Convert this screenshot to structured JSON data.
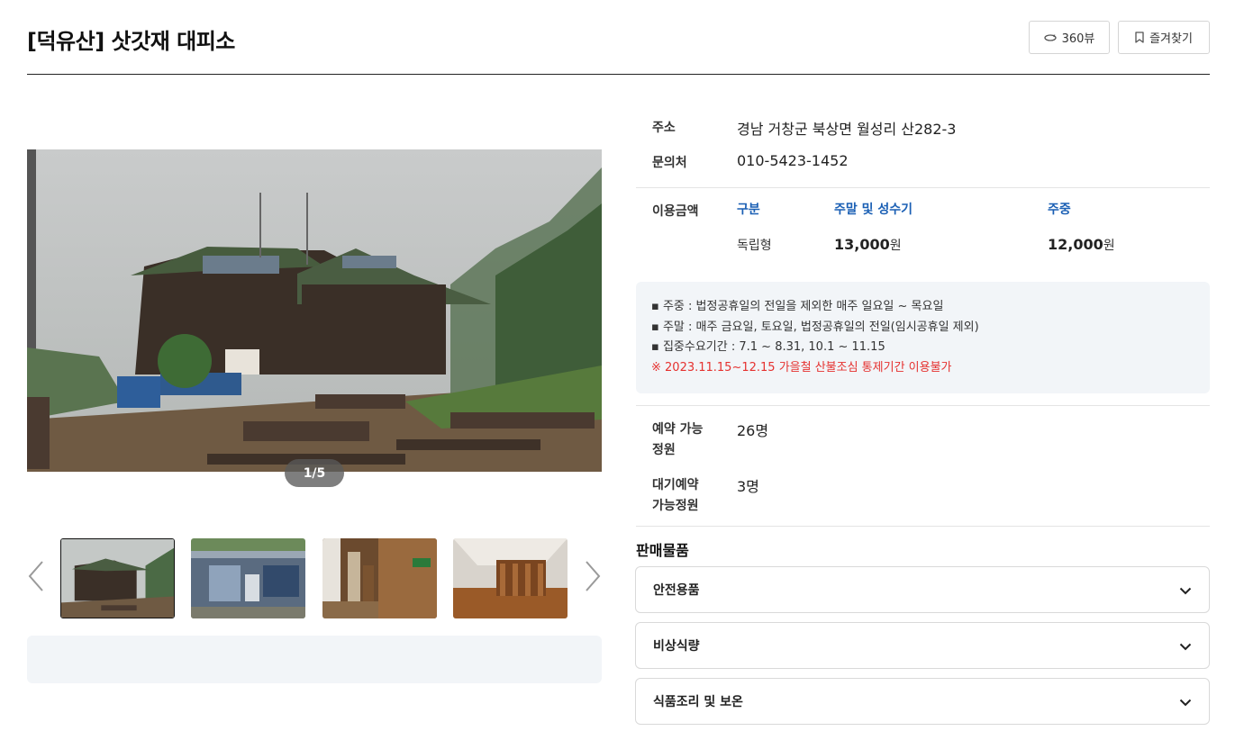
{
  "page": {
    "title": "[덕유산] 삿갓재 대피소"
  },
  "header": {
    "view360_label": "360뷰",
    "favorite_label": "즐겨찾기"
  },
  "gallery": {
    "counter": "1/5"
  },
  "info": {
    "address_label": "주소",
    "address": "경남 거창군 북상면 월성리 산282-3",
    "contact_label": "문의처",
    "contact": "010-5423-1452",
    "fee_label": "이용금액",
    "fee_headers": [
      "구분",
      "주말 및 성수기",
      "주중"
    ],
    "fee_row": {
      "type": "독립형",
      "weekend": "13,000",
      "weekday": "12,000",
      "unit": "원"
    },
    "capacity_label_1": "예약 가능",
    "capacity_label_2": "정원",
    "capacity": "26명",
    "waitlist_label_1": "대기예약",
    "waitlist_label_2": "가능정원",
    "waitlist": "3명"
  },
  "notice": {
    "lines": [
      "주중 : 법정공휴일의 전일을 제외한 매주 일요일 ~ 목요일",
      "주말 : 매주 금요일, 토요일, 법정공휴일의 전일(임시공휴일 제외)",
      "집중수요기간 : 7.1 ~ 8.31, 10.1 ~ 11.15"
    ],
    "warning": "※ 2023.11.15~12.15 가을철 산불조심 통제기간 이용불가"
  },
  "sales": {
    "title": "판매물품",
    "items": [
      "안전용품",
      "비상식량",
      "식품조리 및 보온"
    ]
  },
  "colors": {
    "accent": "#1a5fb4",
    "warning": "#e5312f",
    "panel_bg": "#f2f5f8"
  }
}
